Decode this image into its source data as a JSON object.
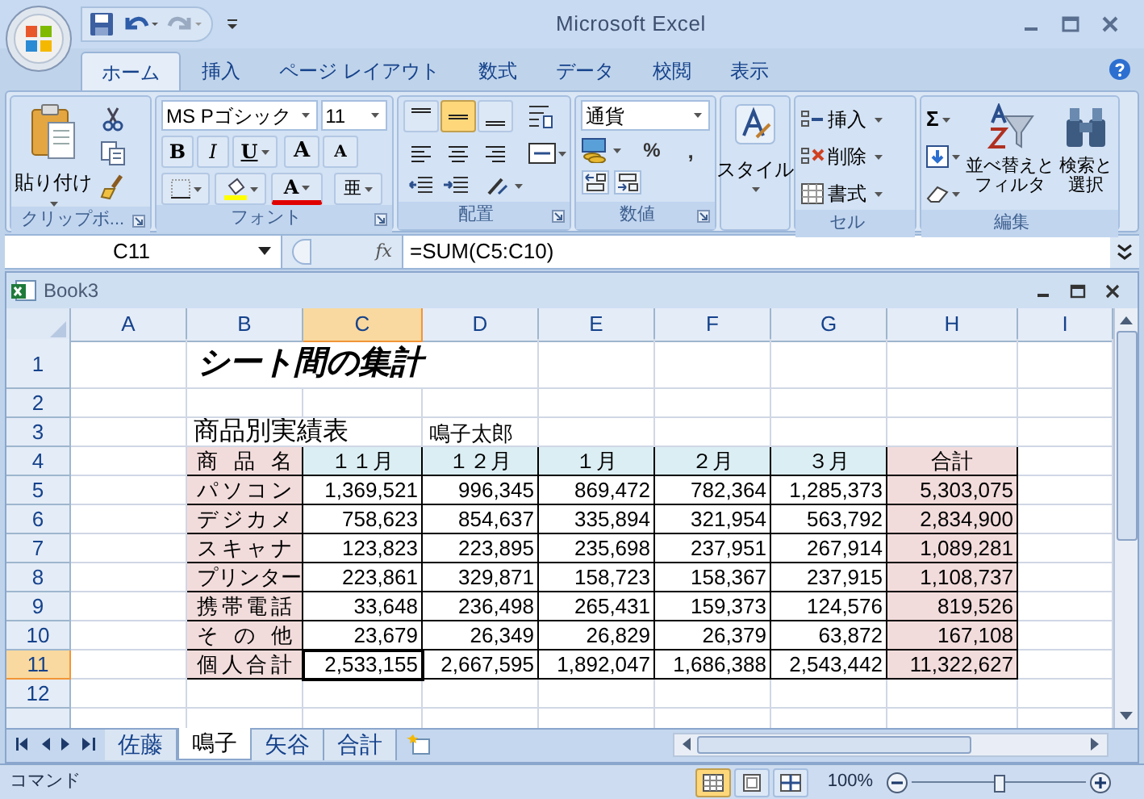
{
  "window": {
    "title": "Microsoft Excel"
  },
  "ribbon_tabs": [
    {
      "label": "ホーム",
      "selected": true
    },
    {
      "label": "挿入",
      "selected": false
    },
    {
      "label": "ページ レイアウト",
      "selected": false
    },
    {
      "label": "数式",
      "selected": false
    },
    {
      "label": "データ",
      "selected": false
    },
    {
      "label": "校閲",
      "selected": false
    },
    {
      "label": "表示",
      "selected": false
    }
  ],
  "clipboard": {
    "paste": "貼り付け",
    "group": "クリップボ..."
  },
  "font": {
    "name": "MS Pゴシック",
    "size": "11",
    "bold": "B",
    "italic": "I",
    "underline": "U",
    "grow": "A",
    "shrink": "A",
    "color_letter": "A",
    "phonetic": "亜",
    "group": "フォント"
  },
  "alignment": {
    "vertical": [
      {
        "selected": false
      },
      {
        "selected": true
      },
      {
        "selected": false
      }
    ],
    "group": "配置"
  },
  "number": {
    "format": "通貨",
    "percent": "%",
    "comma": ",",
    "group": "数値"
  },
  "styles": {
    "label": "スタイル"
  },
  "cells": {
    "items": [
      "挿入",
      "削除",
      "書式"
    ],
    "group": "セル"
  },
  "editing": {
    "sum": "Σ",
    "sort": "並べ替えとフィルタ",
    "find": "検索と選択",
    "group": "編集"
  },
  "name_box": "C11",
  "function_button": "fx",
  "formula": "=SUM(C5:C10)",
  "workbook": {
    "title": "Book3"
  },
  "columns": [
    {
      "label": "A",
      "selected": false
    },
    {
      "label": "B",
      "selected": false
    },
    {
      "label": "C",
      "selected": true
    },
    {
      "label": "D",
      "selected": false
    },
    {
      "label": "E",
      "selected": false
    },
    {
      "label": "F",
      "selected": false
    },
    {
      "label": "G",
      "selected": false
    },
    {
      "label": "H",
      "selected": false
    },
    {
      "label": "I",
      "selected": false
    }
  ],
  "rows": [
    {
      "header": "1",
      "selected": false,
      "cells": [
        {
          "kind": "blank"
        },
        {
          "kind": "title",
          "text": "シート間の集計"
        },
        {
          "kind": "blank"
        },
        {
          "kind": "blank"
        },
        {
          "kind": "blank"
        },
        {
          "kind": "blank"
        },
        {
          "kind": "blank"
        }
      ]
    },
    {
      "header": "2",
      "selected": false,
      "cells": [
        {
          "kind": "blank"
        },
        {
          "kind": "blank"
        },
        {
          "kind": "blank"
        },
        {
          "kind": "blank"
        },
        {
          "kind": "blank"
        },
        {
          "kind": "blank"
        },
        {
          "kind": "blank"
        },
        {
          "kind": "blank"
        },
        {
          "kind": "blank"
        }
      ]
    },
    {
      "header": "3",
      "selected": false,
      "cells": [
        {
          "kind": "blank"
        },
        {
          "kind": "subtitle",
          "text": "商品別実績表"
        },
        {
          "kind": "note",
          "text": "鳴子太郎"
        },
        {
          "kind": "blank"
        },
        {
          "kind": "blank"
        },
        {
          "kind": "blank"
        },
        {
          "kind": "blank"
        },
        {
          "kind": "blank"
        }
      ]
    },
    {
      "header": "4",
      "selected": false,
      "cells": [
        {
          "kind": "blank"
        },
        {
          "kind": "label",
          "text": "商品名"
        },
        {
          "kind": "heading",
          "text": "１１月"
        },
        {
          "kind": "heading",
          "text": "１２月"
        },
        {
          "kind": "heading",
          "text": "１月"
        },
        {
          "kind": "heading",
          "text": "２月"
        },
        {
          "kind": "heading",
          "text": "３月"
        },
        {
          "kind": "total_heading",
          "text": "合計"
        },
        {
          "kind": "blank"
        }
      ]
    },
    {
      "header": "5",
      "selected": false,
      "cells": [
        {
          "kind": "blank"
        },
        {
          "kind": "label",
          "text": "パソコン"
        },
        {
          "kind": "number",
          "text": "1,369,521"
        },
        {
          "kind": "number",
          "text": "996,345"
        },
        {
          "kind": "number",
          "text": "869,472"
        },
        {
          "kind": "number",
          "text": "782,364"
        },
        {
          "kind": "number",
          "text": "1,285,373"
        },
        {
          "kind": "total",
          "text": "5,303,075"
        },
        {
          "kind": "blank"
        }
      ]
    },
    {
      "header": "6",
      "selected": false,
      "cells": [
        {
          "kind": "blank"
        },
        {
          "kind": "label",
          "text": "デジカメ"
        },
        {
          "kind": "number",
          "text": "758,623"
        },
        {
          "kind": "number",
          "text": "854,637"
        },
        {
          "kind": "number",
          "text": "335,894"
        },
        {
          "kind": "number",
          "text": "321,954"
        },
        {
          "kind": "number",
          "text": "563,792"
        },
        {
          "kind": "total",
          "text": "2,834,900"
        },
        {
          "kind": "blank"
        }
      ]
    },
    {
      "header": "7",
      "selected": false,
      "cells": [
        {
          "kind": "blank"
        },
        {
          "kind": "label",
          "text": "スキャナ"
        },
        {
          "kind": "number",
          "text": "123,823"
        },
        {
          "kind": "number",
          "text": "223,895"
        },
        {
          "kind": "number",
          "text": "235,698"
        },
        {
          "kind": "number",
          "text": "237,951"
        },
        {
          "kind": "number",
          "text": "267,914"
        },
        {
          "kind": "total",
          "text": "1,089,281"
        },
        {
          "kind": "blank"
        }
      ]
    },
    {
      "header": "8",
      "selected": false,
      "cells": [
        {
          "kind": "blank"
        },
        {
          "kind": "label",
          "text": "プリンター"
        },
        {
          "kind": "number",
          "text": "223,861"
        },
        {
          "kind": "number",
          "text": "329,871"
        },
        {
          "kind": "number",
          "text": "158,723"
        },
        {
          "kind": "number",
          "text": "158,367"
        },
        {
          "kind": "number",
          "text": "237,915"
        },
        {
          "kind": "total",
          "text": "1,108,737"
        },
        {
          "kind": "blank"
        }
      ]
    },
    {
      "header": "9",
      "selected": false,
      "cells": [
        {
          "kind": "blank"
        },
        {
          "kind": "label",
          "text": "携帯電話"
        },
        {
          "kind": "number",
          "text": "33,648"
        },
        {
          "kind": "number",
          "text": "236,498"
        },
        {
          "kind": "number",
          "text": "265,431"
        },
        {
          "kind": "number",
          "text": "159,373"
        },
        {
          "kind": "number",
          "text": "124,576"
        },
        {
          "kind": "total",
          "text": "819,526"
        },
        {
          "kind": "blank"
        }
      ]
    },
    {
      "header": "10",
      "selected": false,
      "cells": [
        {
          "kind": "blank"
        },
        {
          "kind": "label",
          "text": "その他"
        },
        {
          "kind": "number",
          "text": "23,679"
        },
        {
          "kind": "number",
          "text": "26,349"
        },
        {
          "kind": "number",
          "text": "26,829"
        },
        {
          "kind": "number",
          "text": "26,379"
        },
        {
          "kind": "number",
          "text": "63,872"
        },
        {
          "kind": "total",
          "text": "167,108"
        },
        {
          "kind": "blank"
        }
      ]
    },
    {
      "header": "11",
      "selected": true,
      "cells": [
        {
          "kind": "blank"
        },
        {
          "kind": "label",
          "text": "個人合計"
        },
        {
          "kind": "number",
          "text": "2,533,155"
        },
        {
          "kind": "number",
          "text": "2,667,595"
        },
        {
          "kind": "number",
          "text": "1,892,047"
        },
        {
          "kind": "number",
          "text": "1,686,388"
        },
        {
          "kind": "number",
          "text": "2,543,442"
        },
        {
          "kind": "total",
          "text": "11,322,627"
        },
        {
          "kind": "blank"
        }
      ]
    },
    {
      "header": "12",
      "selected": false,
      "cells": [
        {
          "kind": "blank"
        },
        {
          "kind": "blank"
        },
        {
          "kind": "blank"
        },
        {
          "kind": "blank"
        },
        {
          "kind": "blank"
        },
        {
          "kind": "blank"
        },
        {
          "kind": "blank"
        },
        {
          "kind": "blank"
        },
        {
          "kind": "blank"
        }
      ]
    }
  ],
  "sheet_tabs": [
    {
      "label": "佐藤",
      "selected": false
    },
    {
      "label": "鳴子",
      "selected": true
    },
    {
      "label": "矢谷",
      "selected": false
    },
    {
      "label": "合計",
      "selected": false
    }
  ],
  "status_bar": {
    "mode": "コマンド",
    "views": [
      {
        "selected": true
      },
      {
        "selected": false
      },
      {
        "selected": false
      }
    ],
    "zoom": "100%",
    "zoom_slider": {
      "level": 0.5
    }
  }
}
